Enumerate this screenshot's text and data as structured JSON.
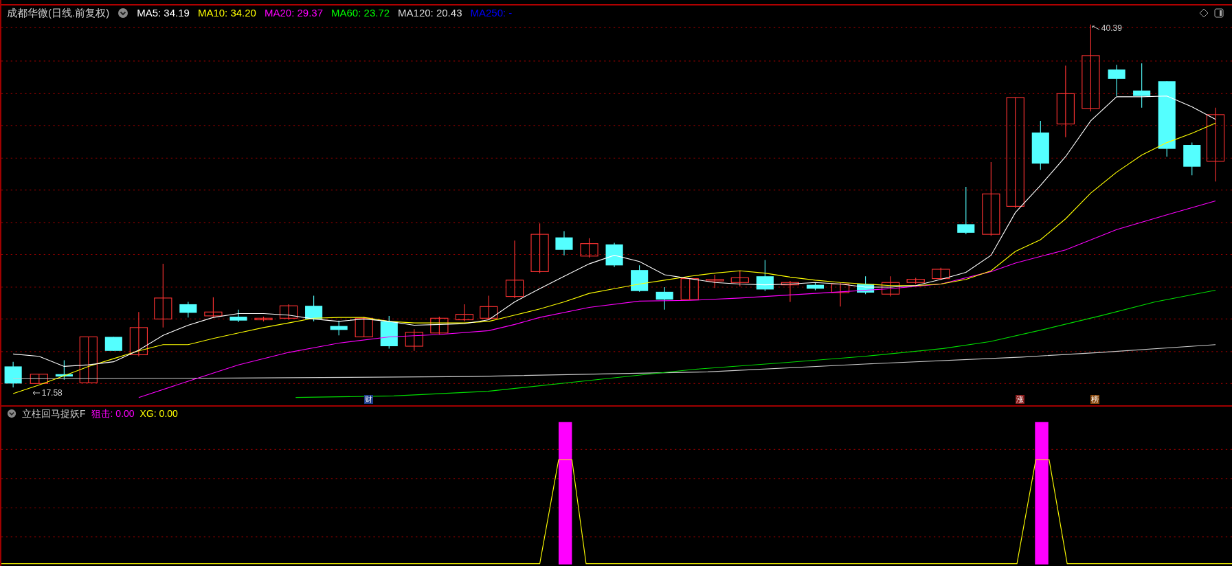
{
  "header": {
    "title": "成都华微(日线.前复权)",
    "moving_averages": [
      {
        "label": "MA5: 34.19",
        "color": "#ffffff"
      },
      {
        "label": "MA10: 34.20",
        "color": "#ffff00"
      },
      {
        "label": "MA20: 29.37",
        "color": "#ff00ff"
      },
      {
        "label": "MA60: 23.72",
        "color": "#00ff00"
      },
      {
        "label": "MA120: 20.43",
        "color": "#dddddd"
      },
      {
        "label": "MA250: -",
        "color": "#0000ff"
      }
    ]
  },
  "main_chart": {
    "high_label": "40.39",
    "low_label": "17.58",
    "markers": [
      {
        "text": "财",
        "color": "#1a3a8a"
      },
      {
        "text": "涨",
        "color": "#8a1a1a"
      },
      {
        "text": "榜",
        "color": "#8a4a10"
      }
    ]
  },
  "indicator": {
    "name": "立柱回马捉妖F",
    "values": [
      {
        "label": "狙击: 0.00",
        "color": "#ff00ff"
      },
      {
        "label": "XG: 0.00",
        "color": "#ffff00"
      }
    ]
  }
}
